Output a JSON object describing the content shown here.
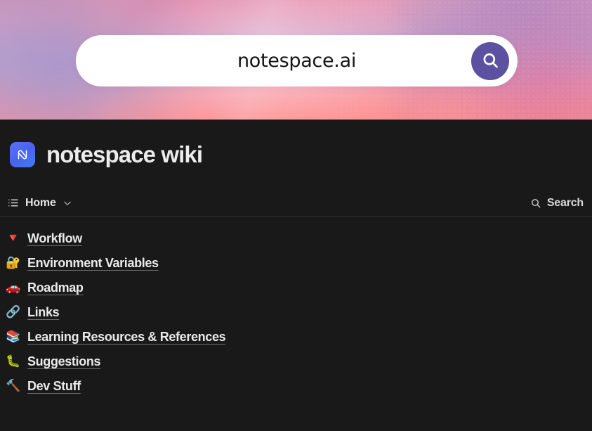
{
  "banner": {
    "alt_description": "watercolor pink and lavender gradient cover image",
    "colors": {
      "lavender": "#a296cb",
      "rose": "#ee82a0",
      "coral": "#fb8e8c",
      "magenta": "#d870a0"
    },
    "search_pill": {
      "text": "notespace.ai",
      "button_icon": "search-icon",
      "button_color": "#5b51a0",
      "pill_background": "#ffffff"
    }
  },
  "header": {
    "logo_icon": "notespace-n-logo-icon",
    "logo_color": "#4a63ef",
    "title": "notespace wiki"
  },
  "navbar": {
    "menu_icon": "list-menu-icon",
    "home_label": "Home",
    "chevron_icon": "chevron-down-icon",
    "search_icon": "search-icon",
    "search_label": "Search"
  },
  "links": [
    {
      "emoji": "🔻",
      "emoji_name": "red-diamond-icon",
      "label": "Workflow"
    },
    {
      "emoji": "🔐",
      "emoji_name": "lock-with-key-icon",
      "label": "Environment Variables"
    },
    {
      "emoji": "🚗",
      "emoji_name": "car-icon",
      "label": "Roadmap"
    },
    {
      "emoji": "🔗",
      "emoji_name": "link-chain-icon",
      "label": "Links"
    },
    {
      "emoji": "📚",
      "emoji_name": "books-icon",
      "label": "Learning Resources & References"
    },
    {
      "emoji": "🐛",
      "emoji_name": "bug-icon",
      "label": "Suggestions"
    },
    {
      "emoji": "🔨",
      "emoji_name": "hammer-icon",
      "label": "Dev Stuff"
    }
  ],
  "theme": {
    "background": "#191919",
    "text": "#eaeaea",
    "divider": "#2c2c2c"
  }
}
